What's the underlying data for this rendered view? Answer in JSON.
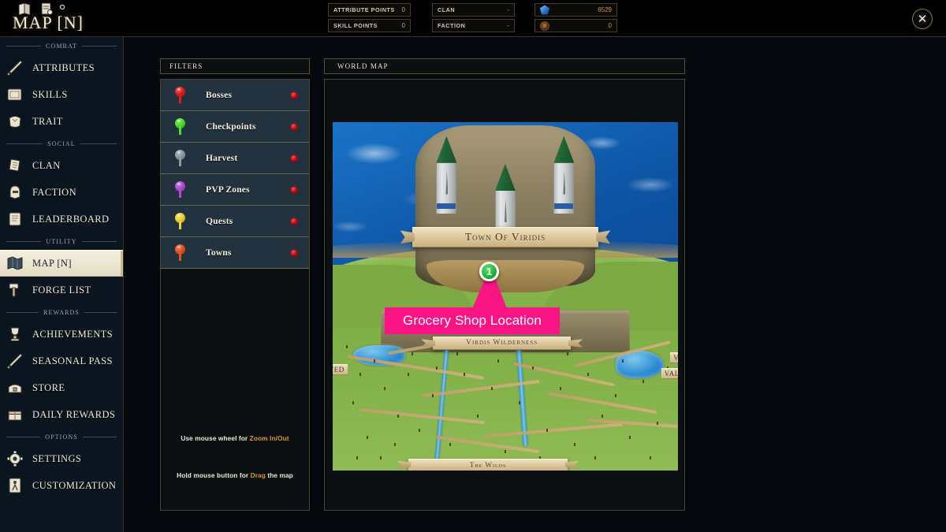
{
  "window": {
    "title": "MAP [N]",
    "close_label": "✕"
  },
  "topbar": {
    "stats": [
      {
        "label": "ATTRIBUTE POINTS",
        "value": "0"
      },
      {
        "label": "SKILL POINTS",
        "value": "0"
      },
      {
        "label": "CLAN",
        "value": "-"
      },
      {
        "label": "FACTION",
        "value": "-"
      }
    ],
    "currencies": [
      {
        "icon": "gem-icon",
        "value": "6529"
      },
      {
        "icon": "coin-icon",
        "value": "0"
      }
    ]
  },
  "sidebar": {
    "sections": [
      {
        "title": "COMBAT",
        "items": [
          {
            "label": "ATTRIBUTES",
            "icon": "sword-icon",
            "active": false
          },
          {
            "label": "SKILLS",
            "icon": "book-icon",
            "active": false
          },
          {
            "label": "TRAIT",
            "icon": "armor-icon",
            "active": false
          }
        ]
      },
      {
        "title": "SOCIAL",
        "items": [
          {
            "label": "CLAN",
            "icon": "banner-icon",
            "active": false
          },
          {
            "label": "FACTION",
            "icon": "helmet-icon",
            "active": false
          },
          {
            "label": "LEADERBOARD",
            "icon": "scroll-icon",
            "active": false
          }
        ]
      },
      {
        "title": "UTILITY",
        "items": [
          {
            "label": "MAP [N]",
            "icon": "map-icon",
            "active": true
          },
          {
            "label": "FORGE LIST",
            "icon": "hammer-icon",
            "active": false
          }
        ]
      },
      {
        "title": "REWARDS",
        "items": [
          {
            "label": "ACHIEVEMENTS",
            "icon": "trophy-icon",
            "active": false
          },
          {
            "label": "SEASONAL PASS",
            "icon": "sword-icon",
            "active": false
          },
          {
            "label": "STORE",
            "icon": "chest-icon",
            "active": false
          },
          {
            "label": "DAILY REWARDS",
            "icon": "gift-icon",
            "active": false
          }
        ]
      },
      {
        "title": "OPTIONS",
        "items": [
          {
            "label": "SETTINGS",
            "icon": "gear-icon",
            "active": false
          },
          {
            "label": "CUSTOMIZATION",
            "icon": "person-icon",
            "active": false
          }
        ]
      }
    ]
  },
  "filters": {
    "header": "FILTERS",
    "items": [
      {
        "label": "Bosses",
        "pin_color": "#e01b1b",
        "toggle": "off"
      },
      {
        "label": "Checkpoints",
        "pin_color": "#4ddc2a",
        "toggle": "off"
      },
      {
        "label": "Harvest",
        "pin_color": "#8d9aa2",
        "toggle": "off"
      },
      {
        "label": "PVP Zones",
        "pin_color": "#b04ad6",
        "toggle": "off"
      },
      {
        "label": "Quests",
        "pin_color": "#ecd22e",
        "toggle": "off"
      },
      {
        "label": "Towns",
        "pin_color": "#e8501e",
        "toggle": "off"
      }
    ],
    "hints": [
      {
        "prefix": "Use mouse wheel for ",
        "highlight": "Zoom In/Out",
        "suffix": ""
      },
      {
        "prefix": "Hold mouse button for ",
        "highlight": "Drag",
        "suffix": " the map"
      }
    ]
  },
  "map": {
    "header": "WORLD MAP",
    "banners": {
      "town": "Town Of Viridis",
      "wilderness": "Virdis Wilderness",
      "bottom": "The Wilds"
    },
    "edge_labels": {
      "left": "STED",
      "right_1": "VER",
      "right_2": "VALE"
    },
    "marker": {
      "number": "1",
      "callout": "Grocery Shop Location",
      "callout_color": "#fa1484",
      "badge_color": "#19b33a"
    }
  }
}
